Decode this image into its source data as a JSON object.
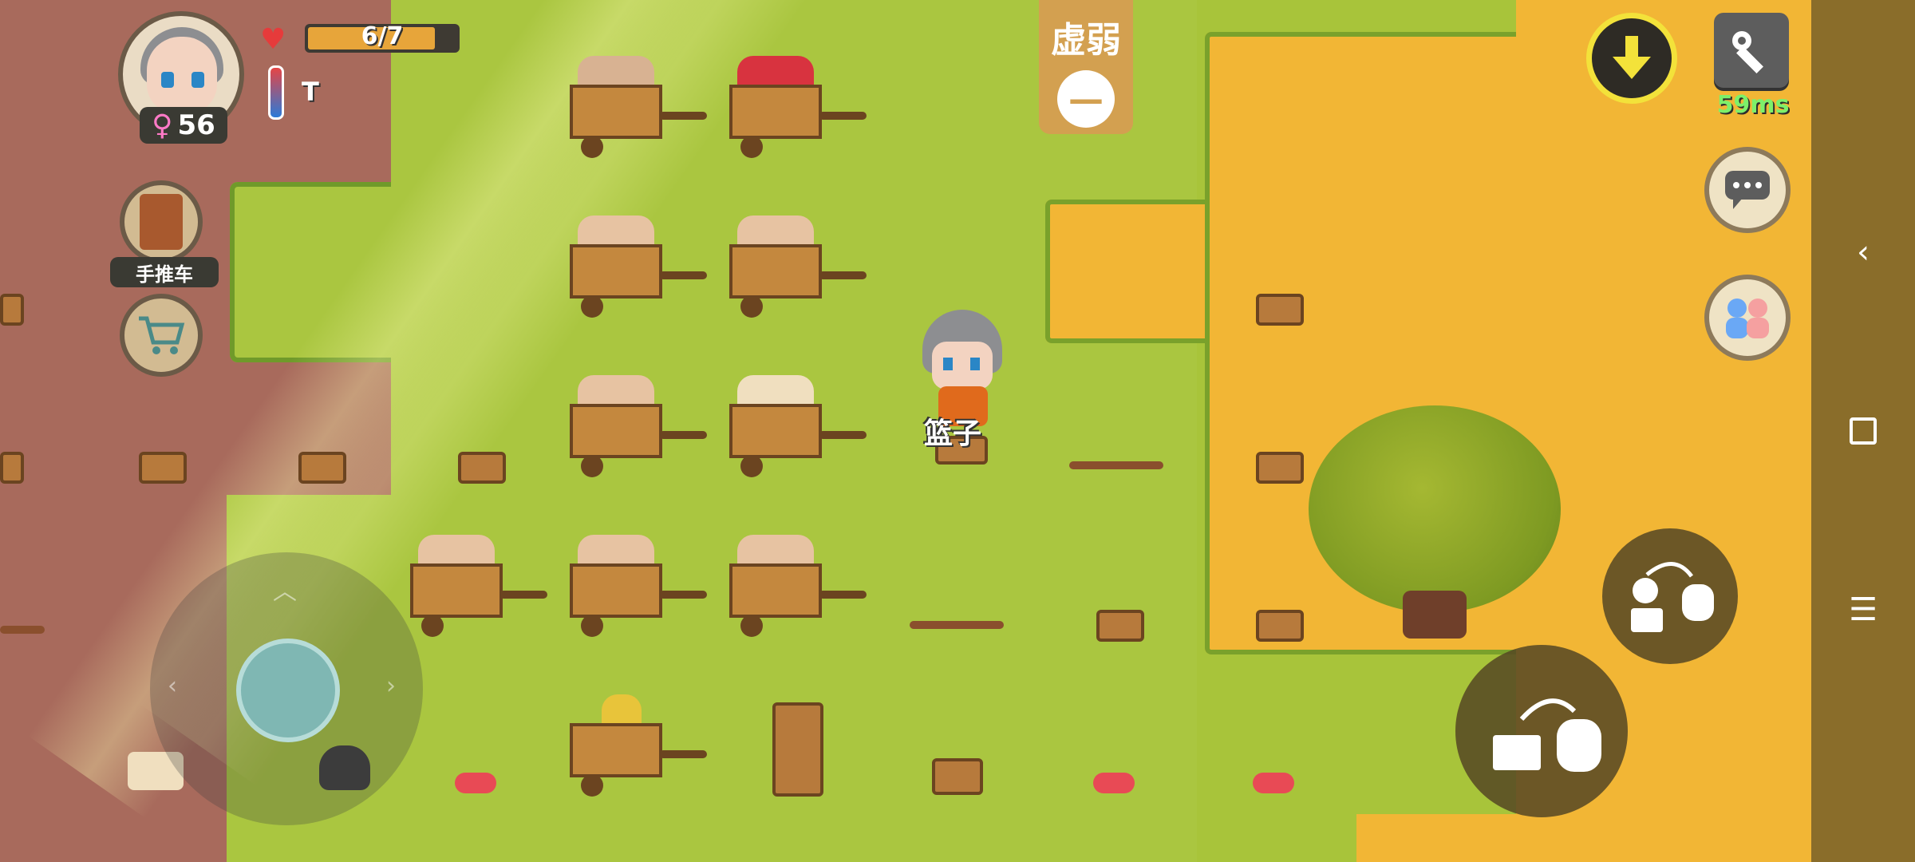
{
  "hud": {
    "age": "56",
    "hunger_text": "6/7",
    "hunger_fraction": 0.857,
    "temp_label": "T",
    "status_effect": "虚弱",
    "handcart_label": "手推车",
    "ping": "59ms"
  },
  "world": {
    "held_item_label": "篮子"
  },
  "icons": {
    "heart": "heart-icon",
    "female": "female-icon",
    "download": "download-icon",
    "settings": "wrench-icon",
    "chat": "chat-icon",
    "friends": "friends-icon"
  },
  "colors": {
    "dirt": "#a86a5c",
    "grass": "#aac640",
    "sand": "#f2b635",
    "accent_yellow": "#f3e23a",
    "ping_green": "#7df06a"
  }
}
